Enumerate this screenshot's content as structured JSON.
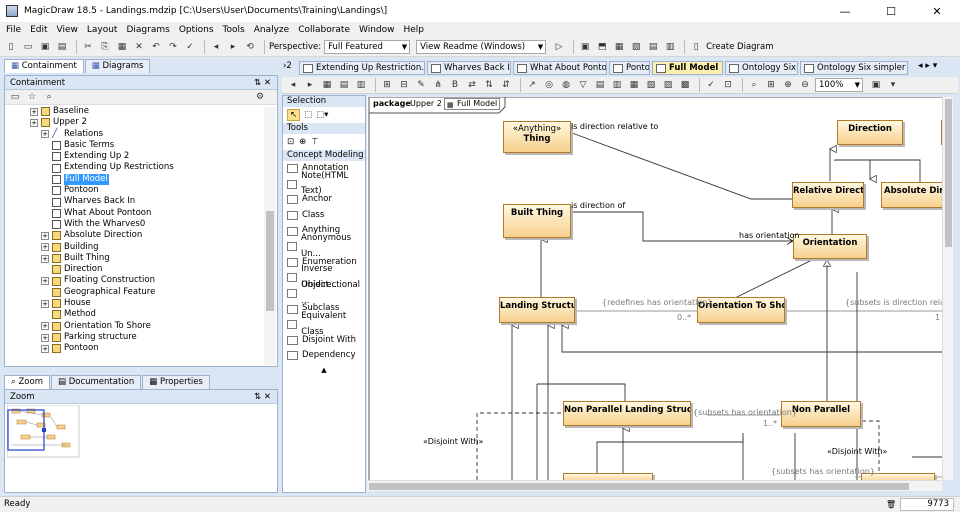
{
  "window": {
    "title": "MagicDraw 18.5 - Landings.mdzip [C:\\Users\\User\\Documents\\Training\\Landings\\]",
    "min_glyph": "—",
    "max_glyph": "☐",
    "close_glyph": "✕"
  },
  "menu": [
    "File",
    "Edit",
    "View",
    "Layout",
    "Diagrams",
    "Options",
    "Tools",
    "Analyze",
    "Collaborate",
    "Window",
    "Help"
  ],
  "toolbar": {
    "perspective_label": "Perspective:",
    "perspective_value": "Full Featured",
    "view_readme": "View Readme (Windows)",
    "create_diagram": "Create Diagram"
  },
  "left_tabs": {
    "containment": "Containment",
    "diagrams": "Diagrams"
  },
  "containment": {
    "header": "Containment",
    "items": [
      {
        "label": "Baseline",
        "indent": 1,
        "kind": "pkg",
        "exp": true
      },
      {
        "label": "Upper 2",
        "indent": 1,
        "kind": "pkg",
        "exp": true
      },
      {
        "label": "Relations",
        "indent": 2,
        "kind": "rel",
        "exp": true
      },
      {
        "label": "Basic Terms",
        "indent": 2,
        "kind": "diag",
        "exp": false
      },
      {
        "label": "Extending Up 2",
        "indent": 2,
        "kind": "diag",
        "exp": false
      },
      {
        "label": "Extending Up Restrictions",
        "indent": 2,
        "kind": "diag",
        "exp": false
      },
      {
        "label": "Full Model",
        "indent": 2,
        "kind": "diag",
        "exp": false,
        "selected": true
      },
      {
        "label": "Pontoon",
        "indent": 2,
        "kind": "diag",
        "exp": false
      },
      {
        "label": "Wharves Back In",
        "indent": 2,
        "kind": "diag",
        "exp": false
      },
      {
        "label": "What About Pontoon",
        "indent": 2,
        "kind": "diag",
        "exp": false
      },
      {
        "label": "With the Wharves0",
        "indent": 2,
        "kind": "diag",
        "exp": false
      },
      {
        "label": "Absolute Direction",
        "indent": 2,
        "kind": "cls",
        "exp": true
      },
      {
        "label": "Building",
        "indent": 2,
        "kind": "cls",
        "exp": true
      },
      {
        "label": "Built Thing",
        "indent": 2,
        "kind": "cls",
        "exp": true
      },
      {
        "label": "Direction",
        "indent": 2,
        "kind": "cls",
        "exp": false
      },
      {
        "label": "Floating Construction",
        "indent": 2,
        "kind": "cls",
        "exp": true
      },
      {
        "label": "Geographical Feature",
        "indent": 2,
        "kind": "cls",
        "exp": false
      },
      {
        "label": "House",
        "indent": 2,
        "kind": "cls",
        "exp": true
      },
      {
        "label": "Method",
        "indent": 2,
        "kind": "cls",
        "exp": false
      },
      {
        "label": "Orientation To Shore",
        "indent": 2,
        "kind": "cls",
        "exp": true
      },
      {
        "label": "Parking structure",
        "indent": 2,
        "kind": "cls",
        "exp": true
      },
      {
        "label": "Pontoon",
        "indent": 2,
        "kind": "cls",
        "exp": true
      }
    ]
  },
  "bottom_tabs": {
    "zoom": "Zoom",
    "documentation": "Documentation",
    "properties": "Properties"
  },
  "zoom_panel": {
    "header": "Zoom"
  },
  "palette": {
    "selection": "Selection",
    "tools": "Tools",
    "concept_modeling": "Concept Modeling",
    "items": [
      "Annotation",
      "Note(HTML Text)",
      "Anchor",
      "Class",
      "Anything",
      "Anonymous Un...",
      "Enumeration",
      "Inverse Object...",
      "Unidirectional ...",
      "Subclass",
      "Equivalent Class",
      "Disjoint With",
      "Dependency"
    ]
  },
  "diagram_tabs": [
    {
      "label": "Extending Up Restriction..."
    },
    {
      "label": "Wharves Back In"
    },
    {
      "label": "What About Pontoon"
    },
    {
      "label": "Pontoon"
    },
    {
      "label": "Full Model",
      "active": true
    },
    {
      "label": "Ontology Six"
    },
    {
      "label": "Ontology Six simpler vie..."
    }
  ],
  "tab_overflow": "2",
  "diagram_toolbar": {
    "zoom": "100%"
  },
  "diagram": {
    "package_kw": "package",
    "package_name": "Upper 2",
    "frame_diagram": "Full Model",
    "classes": {
      "anything_st": "«Anything»",
      "thing": "Thing",
      "direction": "Direction",
      "relative_direction": "Relative Direction",
      "absolute_direction": "Absolute Direction",
      "built_thing": "Built Thing",
      "orientation": "Orientation",
      "landing_structure": "Landing Structure",
      "orientation_to_shore": "Orientation To Shore",
      "non_parallel_landing": "Non Parallel Landing Structure",
      "non_parallel": "Non Parallel"
    },
    "labels": {
      "is_dir_rel_to": "is direction relative to",
      "is_dir_of": "is direction of",
      "has_orientation": "has orientation",
      "redefines": "{redefines has orientation}",
      "subsets_dir": "{subsets is direction relative",
      "subsets_has": "{subsets has orientation}",
      "subsets_has2": "{subsets has orientation}",
      "mult1": "0..*",
      "mult2": "1",
      "mult3": "1..*",
      "disjoint1": "«Disjoint With»",
      "disjoint2": "«Disjoint With»"
    }
  },
  "status": {
    "text": "Ready",
    "memory": "9773"
  }
}
